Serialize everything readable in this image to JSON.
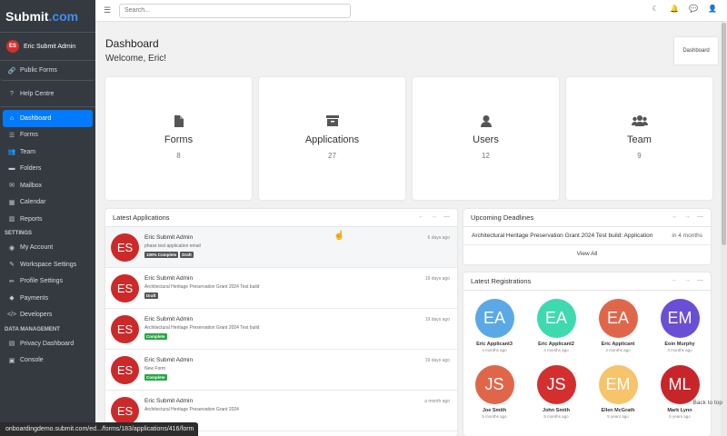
{
  "brand": {
    "name": "Submit",
    "suffix": ".com"
  },
  "user": {
    "initials": "ES",
    "name": "Eric Submit Admin"
  },
  "sidebar": {
    "top_items": [
      {
        "label": "Public Forms",
        "icon": "link-icon"
      },
      {
        "label": "Help Centre",
        "icon": "question-icon"
      }
    ],
    "main_items": [
      {
        "label": "Dashboard",
        "icon": "home-icon",
        "active": true
      },
      {
        "label": "Forms",
        "icon": "list-icon"
      },
      {
        "label": "Team",
        "icon": "team-icon"
      },
      {
        "label": "Folders",
        "icon": "folder-icon"
      },
      {
        "label": "Mailbox",
        "icon": "mail-icon"
      },
      {
        "label": "Calendar",
        "icon": "calendar-icon"
      },
      {
        "label": "Reports",
        "icon": "chart-icon"
      }
    ],
    "settings_header": "SETTINGS",
    "settings_items": [
      {
        "label": "My Account",
        "icon": "user-circle-icon"
      },
      {
        "label": "Workspace Settings",
        "icon": "wrench-icon"
      },
      {
        "label": "Profile Settings",
        "icon": "pencil-icon"
      },
      {
        "label": "Payments",
        "icon": "payment-icon"
      },
      {
        "label": "Developers",
        "icon": "code-icon"
      }
    ],
    "data_header": "DATA MANAGEMENT",
    "data_items": [
      {
        "label": "Privacy Dashboard",
        "icon": "database-icon"
      },
      {
        "label": "Console",
        "icon": "console-icon"
      }
    ]
  },
  "topbar": {
    "search_placeholder": "Search...",
    "icons": [
      "moon-icon",
      "bell-icon",
      "chat-icon",
      "user-icon"
    ]
  },
  "page": {
    "title": "Dashboard",
    "welcome": "Welcome, Eric!",
    "breadcrumb": "Dashboard"
  },
  "stats": [
    {
      "label": "Forms",
      "value": "8",
      "icon": "file-icon"
    },
    {
      "label": "Applications",
      "value": "27",
      "icon": "archive-icon"
    },
    {
      "label": "Users",
      "value": "12",
      "icon": "user-icon"
    },
    {
      "label": "Team",
      "value": "9",
      "icon": "users-icon"
    }
  ],
  "latest_applications": {
    "title": "Latest Applications",
    "items": [
      {
        "initials": "ES",
        "name": "Eric Submit Admin",
        "desc": "phase test application email",
        "date": "6 days ago",
        "badges": [
          {
            "text": "100% Complete",
            "color": "#555555"
          },
          {
            "text": "Draft",
            "color": "#555555"
          }
        ]
      },
      {
        "initials": "ES",
        "name": "Eric Submit Admin",
        "desc": "Architectural Heritage Preservation Grant 2024 Test build",
        "date": "19 days ago",
        "badges": [
          {
            "text": "Draft",
            "color": "#555555"
          }
        ]
      },
      {
        "initials": "ES",
        "name": "Eric Submit Admin",
        "desc": "Architectural Heritage Preservation Grant 2024 Test build",
        "date": "19 days ago",
        "badges": [
          {
            "text": "Complete",
            "color": "#28a745"
          }
        ]
      },
      {
        "initials": "ES",
        "name": "Eric Submit Admin",
        "desc": "New Form",
        "date": "19 days ago",
        "badges": [
          {
            "text": "Complete",
            "color": "#28a745"
          }
        ]
      },
      {
        "initials": "ES",
        "name": "Eric Submit Admin",
        "desc": "Architectural Heritage Preservation Grant 2024",
        "date": "a month ago",
        "badges": []
      }
    ]
  },
  "upcoming_deadlines": {
    "title": "Upcoming Deadlines",
    "items": [
      {
        "name": "Architectural Heritage Preservation Grant 2024 Test build: Application",
        "due": "in 4 months"
      }
    ],
    "view_all": "View All"
  },
  "latest_registrations": {
    "title": "Latest Registrations",
    "items": [
      {
        "initials": "EA",
        "name": "Eric Applicant3",
        "time": "4 months ago",
        "color": "#5aa9e6"
      },
      {
        "initials": "EA",
        "name": "Eric Applicant2",
        "time": "4 months ago",
        "color": "#3fd9b0"
      },
      {
        "initials": "EA",
        "name": "Eric Applicant",
        "time": "4 months ago",
        "color": "#e0664a"
      },
      {
        "initials": "EM",
        "name": "Eoin Murphy",
        "time": "4 months ago",
        "color": "#6a4fd6"
      },
      {
        "initials": "JS",
        "name": "Joe Smith",
        "time": "5 months ago",
        "color": "#e0664a"
      },
      {
        "initials": "JS",
        "name": "John Smith",
        "time": "5 months ago",
        "color": "#d32f2f"
      },
      {
        "initials": "EM",
        "name": "Ellen McGrath",
        "time": "5 years ago",
        "color": "#f7c36b"
      },
      {
        "initials": "ML",
        "name": "Mark Lynn",
        "time": "5 years ago",
        "color": "#c8252b"
      }
    ]
  },
  "status_url": "onboardingdemo.submit.com/ed.../forms/183/applications/416/form",
  "back_to_top": "Back to top"
}
